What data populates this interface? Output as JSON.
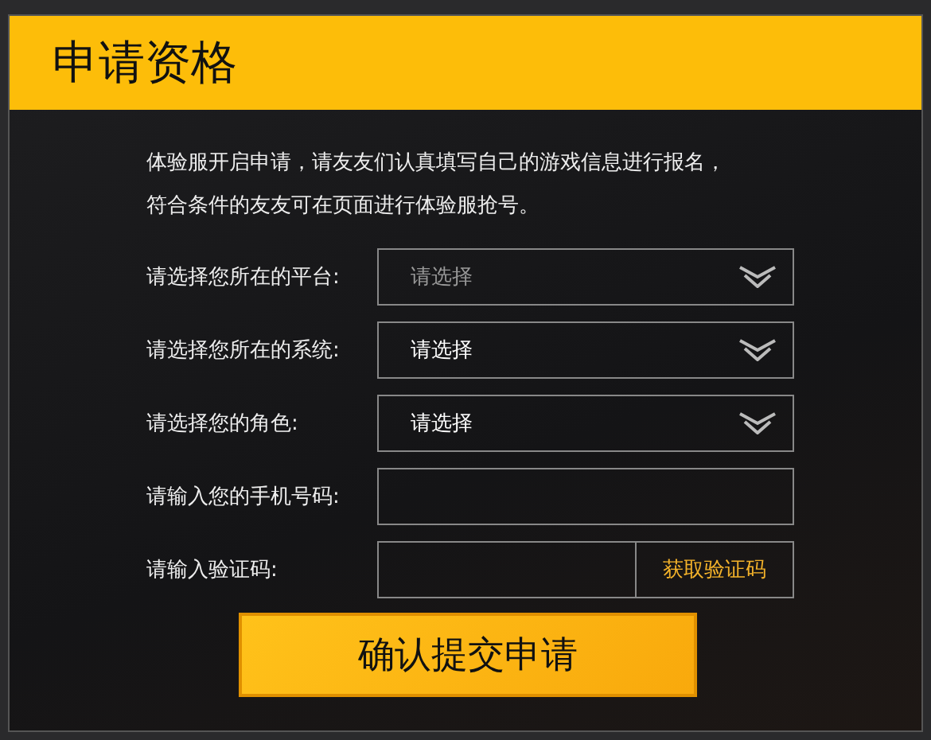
{
  "title": "申请资格",
  "intro": [
    "体验服开启申请，请友友们认真填写自己的游戏信息进行报名，",
    "符合条件的友友可在页面进行体验服抢号。"
  ],
  "fields": [
    {
      "kind": "select",
      "label": "请选择您所在的平台:",
      "value": "请选择",
      "disabled": true
    },
    {
      "kind": "select",
      "label": "请选择您所在的系统:",
      "value": "请选择",
      "disabled": false
    },
    {
      "kind": "select",
      "label": "请选择您的角色:",
      "value": "请选择",
      "disabled": false
    },
    {
      "kind": "text",
      "label": "请输入您的手机号码:"
    },
    {
      "kind": "code",
      "label": "请输入验证码:",
      "button": "获取验证码"
    }
  ],
  "submit": "确认提交申请"
}
